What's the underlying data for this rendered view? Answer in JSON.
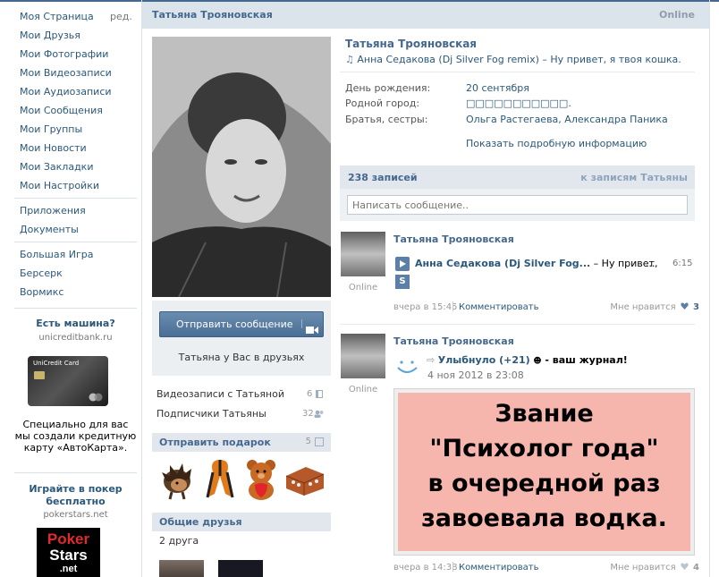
{
  "nav": {
    "items": [
      "Моя Страница",
      "Мои Друзья",
      "Мои Фотографии",
      "Мои Видеозаписи",
      "Мои Аудиозаписи",
      "Мои Сообщения",
      "Мои Группы",
      "Мои Новости",
      "Мои Закладки",
      "Мои Настройки"
    ],
    "edit": "ред.",
    "apps": [
      "Приложения",
      "Документы"
    ],
    "games": [
      "Большая Игра",
      "Берсерк",
      "Вормикс"
    ]
  },
  "ads": [
    {
      "title": "Есть машина?",
      "domain": "unicreditbank.ru",
      "card_brand": "UniCredit Card",
      "text": "Специально для вас мы создали кредитную карту «АвтоКарта»."
    },
    {
      "title": "Играйте в покер бесплатно",
      "domain": "pokerstars.net",
      "logo_lines": [
        "Poker",
        "Stars",
        ".net"
      ]
    }
  ],
  "header": {
    "name": "Татьяна Трояновская",
    "status": "Online"
  },
  "profile": {
    "name": "Татьяна Трояновская",
    "status_text": "Анна Седакова (Dj Silver Fog remix) – Ну привет, я твоя кошка.",
    "fields": [
      {
        "label": "День рождения:",
        "value": "20 сентября"
      },
      {
        "label": "Родной город:",
        "value": "□□□□□□□□□□□."
      },
      {
        "label": "Братья, сестры:",
        "value": "Ольга Растегаева, Александра Паника"
      }
    ],
    "more": "Показать подробную информацию"
  },
  "actions": {
    "send_message": "Отправить сообщение",
    "friends_note": "Татьяна у Вас в друзьях"
  },
  "side": {
    "videos": {
      "label": "Видеозаписи с Татьяной",
      "count": "6"
    },
    "followers": {
      "label": "Подписчики Татьяны",
      "count": "32"
    },
    "gift": {
      "label": "Отправить подарок",
      "count": "5"
    },
    "mutual": {
      "label": "Общие друзья",
      "sub": "2 друга"
    }
  },
  "wall": {
    "count": "238 записей",
    "to_wall": "к записям Татьяны",
    "placeholder": "Написать сообщение.."
  },
  "posts": [
    {
      "author": "Татьяна Трояновская",
      "online": "Online",
      "track_artist": "Анна Седакова (Dj Silver Fog...",
      "track_rest": " – Ну привет,",
      "track_dots": "...",
      "duration": "6:15",
      "s_badge": "S",
      "date": "вчера в 15:45",
      "comment": "Комментировать",
      "like_label": "Мне нравится",
      "likes": "3"
    },
    {
      "author": "Татьяна Трояновская",
      "online": "Online",
      "app_name": "Улыбнуло (+21)",
      "app_rest": " - ваш журнал!",
      "app_date": "4 ноя 2012 в 23:08",
      "image_lines": [
        "Звание",
        "\"Психолог года\"",
        "в очередной раз",
        "завоевала водка."
      ],
      "date": "вчера в 14:38",
      "comment": "Комментировать",
      "like_label": "Мне нравится",
      "likes": "4"
    }
  ],
  "colors": {
    "accent": "#45688e",
    "link": "#2b587a",
    "header_bg": "#dbe3eb",
    "post_image_bg": "#f6b5ad"
  }
}
